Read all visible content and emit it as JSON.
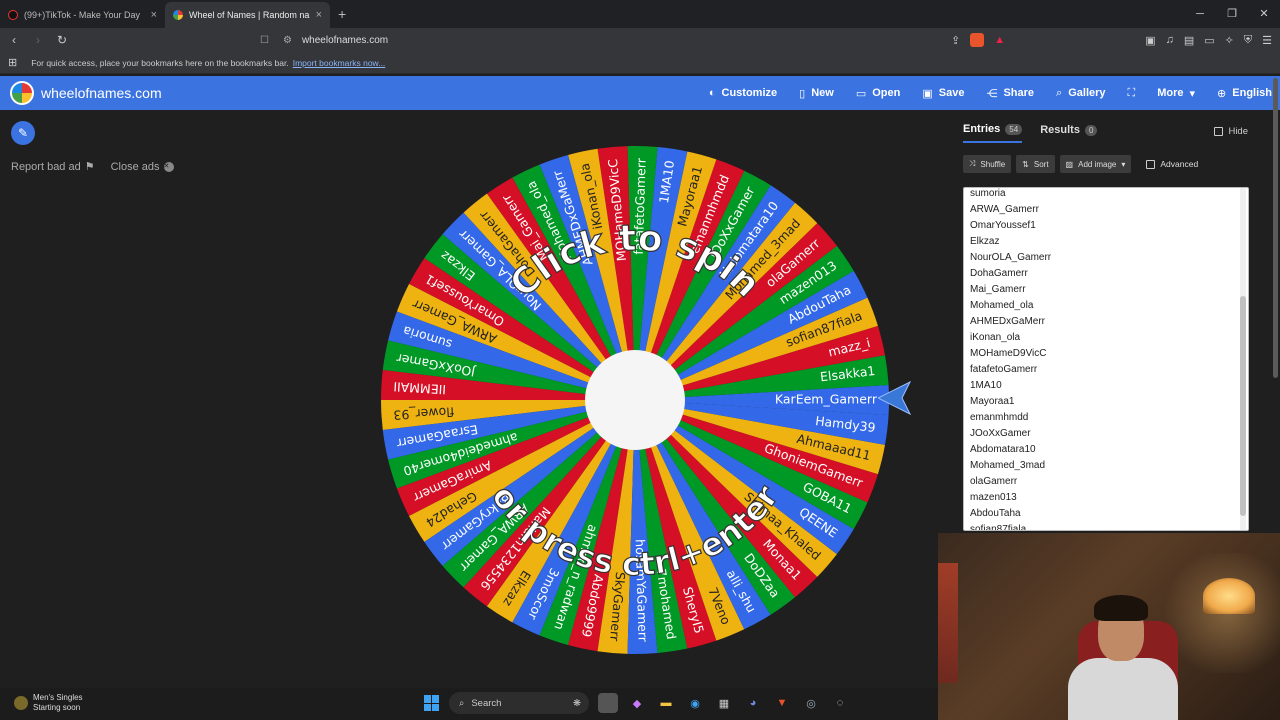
{
  "browser": {
    "tabs": [
      {
        "label": "(99+)TikTok - Make Your Day",
        "active": false
      },
      {
        "label": "Wheel of Names | Random name",
        "active": true
      }
    ],
    "url": "wheelofnames.com",
    "bookmarks_msg": "For quick access, place your bookmarks here on the bookmarks bar.",
    "import_link": "Import bookmarks now..."
  },
  "site": {
    "name": "wheelofnames.com",
    "nav": [
      "Customize",
      "New",
      "Open",
      "Save",
      "Share",
      "Gallery",
      "",
      "More",
      "English"
    ],
    "report_bad_ad": "Report bad ad",
    "close_ads": "Close ads"
  },
  "wheel": {
    "line1": "Click to spin",
    "line2": "or press ctrl+enter",
    "slice_colors": [
      "#3369e8",
      "#009925",
      "#d50f25",
      "#eeb211"
    ],
    "slice_labels": [
      "KarEem_Gamerr",
      "Elsakka1",
      "mazz_i",
      "sofian87fiala",
      "AbdouTaha",
      "mazen013",
      "olaGamerr",
      "Mohamed_3mad",
      "Abdomatara10",
      "JOoXxGamer",
      "emanmhmdd",
      "Mayoraa1",
      "1MA10",
      "fatafetoGamerr",
      "MOHameD9VicC",
      "iKonan_ola",
      "AHMEDxGaMerr",
      "Mohamed_ola",
      "Mai_Gamerr",
      "DohaGamerr",
      "NourOLA_Gamerr",
      "Elkzaz",
      "OmarYoussef1",
      "ARWA_Gamerr",
      "sumoria",
      "JOoXxGamer",
      "IIEMMAII",
      "flower_93",
      "EsraaGamerr",
      "ahmedeid4omer40",
      "AmiraGamerr",
      "Gehad24",
      "BakryGamerr",
      "ARWA_Gamerr",
      "Mariam1234556",
      "Elkzaz",
      "3moScor",
      "ahmed_n_radwan",
      "Abdo9999",
      "SkyGamerr",
      "hosamYaGamerr",
      "7mohamed",
      "SheryI5",
      "7Veno",
      "alli_shu",
      "DoDZaa",
      "Monaa1",
      "Shimaa_Khaled",
      "QEENE",
      "GOBA11",
      "GhoniemGamerr",
      "Ahmaaad11",
      "Hamdy39"
    ]
  },
  "panel": {
    "entries_tab": "Entries",
    "entries_count": "54",
    "results_tab": "Results",
    "results_count": "0",
    "hide_label": "Hide",
    "shuffle": "Shuffle",
    "sort": "Sort",
    "add_image": "Add image",
    "advanced": "Advanced",
    "entries": [
      "sumoria",
      "ARWA_Gamerr",
      "OmarYoussef1",
      "Elkzaz",
      "NourOLA_Gamerr",
      "DohaGamerr",
      "Mai_Gamerr",
      "Mohamed_ola",
      "AHMEDxGaMerr",
      "iKonan_ola",
      "MOHameD9VicC",
      "fatafetoGamerr",
      "1MA10",
      "Mayoraa1",
      "emanmhmdd",
      "JOoXxGamer",
      "Abdomatara10",
      "Mohamed_3mad",
      "olaGamerr",
      "mazen013",
      "AbdouTaha",
      "sofian87fiala"
    ]
  },
  "taskbar": {
    "notif_title": "Men's Singles",
    "notif_sub": "Starting soon",
    "search": "Search"
  }
}
